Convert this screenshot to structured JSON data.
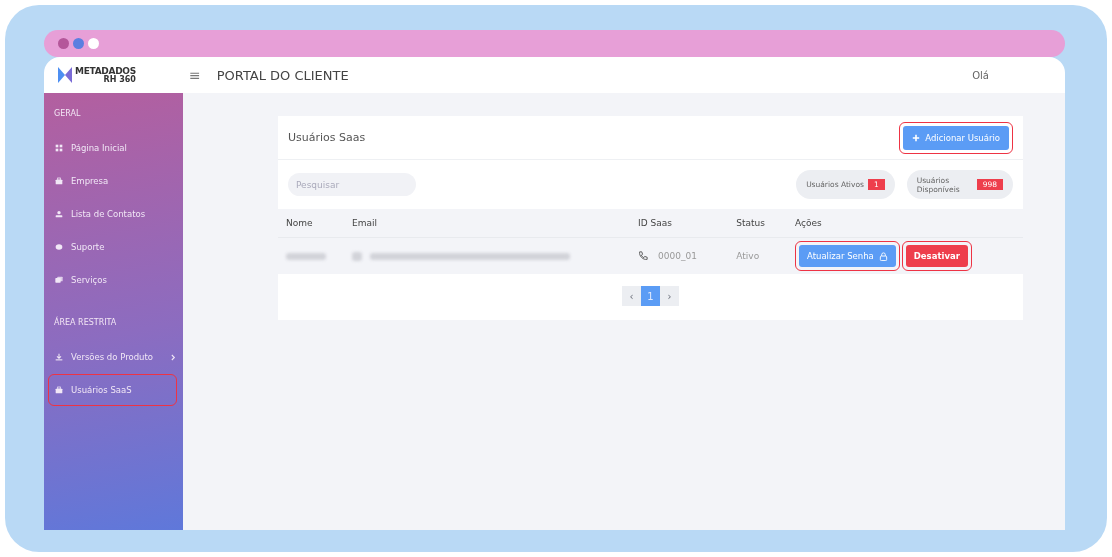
{
  "window": {
    "dots": [
      {
        "color": "#b4579a"
      },
      {
        "color": "#5b7fe0"
      },
      {
        "color": "#ffffff"
      }
    ]
  },
  "header": {
    "logo_name": "METADADOS",
    "logo_sub": "RH 360",
    "menu_icon": "≡",
    "title": "PORTAL DO CLIENTE",
    "greeting": "Olá"
  },
  "sidebar": {
    "sections": [
      {
        "title": "GERAL",
        "items": [
          {
            "label": "Página Inicial",
            "highlighted": false,
            "has_submenu": false
          },
          {
            "label": "Empresa",
            "highlighted": false,
            "has_submenu": false
          },
          {
            "label": "Lista de Contatos",
            "highlighted": false,
            "has_submenu": false
          },
          {
            "label": "Suporte",
            "highlighted": false,
            "has_submenu": false
          },
          {
            "label": "Serviços",
            "highlighted": false,
            "has_submenu": false
          }
        ]
      },
      {
        "title": "ÁREA RESTRITA",
        "items": [
          {
            "label": "Versões do Produto",
            "highlighted": false,
            "has_submenu": true
          },
          {
            "label": "Usuários SaaS",
            "highlighted": true,
            "has_submenu": false
          }
        ]
      }
    ]
  },
  "card": {
    "title": "Usuários Saas",
    "add_button": {
      "label": "Adicionar Usuário",
      "highlighted": true
    },
    "search": {
      "placeholder": "Pesquisar"
    },
    "counters": [
      {
        "label": "Usuários Ativos",
        "value": "1"
      },
      {
        "label": "Usuários Disponíveis",
        "value": "998"
      }
    ],
    "table": {
      "columns": [
        "Nome",
        "Email",
        "ID Saas",
        "Status",
        "Ações"
      ],
      "rows": [
        {
          "id_saas": "0000_01",
          "status": "Ativo",
          "actions": [
            {
              "label": "Atualizar Senha",
              "kind": "primary",
              "highlighted": true
            },
            {
              "label": "Desativar",
              "kind": "danger",
              "highlighted": true
            }
          ]
        }
      ]
    },
    "pagination": {
      "prev": "‹",
      "next": "›",
      "pages": [
        {
          "label": "1",
          "selected": true
        }
      ]
    }
  }
}
